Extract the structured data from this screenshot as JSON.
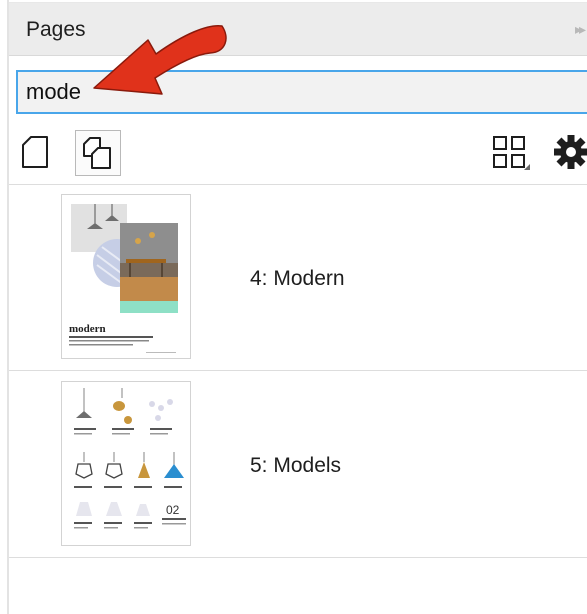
{
  "panel": {
    "title": "Pages",
    "dock_glyph": "▸▸"
  },
  "search": {
    "value": "mode",
    "placeholder": ""
  },
  "toolbar": {
    "icons": [
      "new-page-icon",
      "duplicate-page-icon",
      "view-mode-icon",
      "settings-gear-icon"
    ]
  },
  "pages": [
    {
      "label": "4: Modern",
      "thumb_text": "modern"
    },
    {
      "label": "5: Models",
      "thumb_number": "02"
    }
  ],
  "colors": {
    "accent_border": "#49a6ea",
    "arrow_red": "#e0321b",
    "header_bg": "#ececec",
    "thumb_teal": "#8ee0c6"
  }
}
